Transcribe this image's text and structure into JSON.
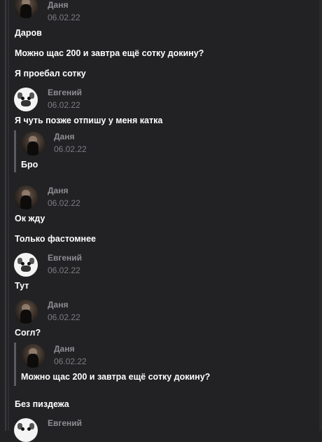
{
  "authors": {
    "dasha": "Даня",
    "evgeny": "Евгений"
  },
  "date": "06.02.22",
  "messages": {
    "m1": "Даров",
    "m2": "Можно щас 200 и завтра ещё сотку докину?",
    "m3": "Я проебал сотку",
    "m4": "Я чуть позже отпишу у меня катка",
    "q1": "Бро",
    "m5": "Ок жду",
    "m6": "Только фастомнее",
    "m7": "Тут",
    "m8": "Согл?",
    "q2": "Можно щас 200 и завтра ещё сотку докину?",
    "m9": "Без пиздежа"
  },
  "avatar_icons": {
    "dasha": "user-photo",
    "evgeny": "dog-avatar-icon"
  }
}
